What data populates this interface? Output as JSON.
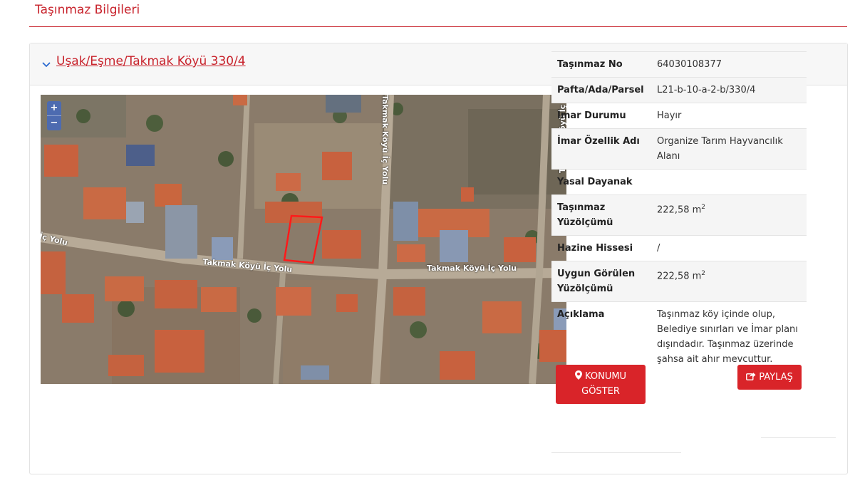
{
  "page": {
    "title": "Taşınmaz Bilgileri"
  },
  "panel": {
    "header_link": "Uşak/Eşme/Takmak Köyü 330/4"
  },
  "map": {
    "zoom_in": "+",
    "zoom_out": "−",
    "road_labels": [
      "İç Yolu",
      "Takmak Köyü İç Yolu",
      "Takmak Köyü İç Yolu",
      "Takmak Köyü İç Yolu",
      "Takmak Köyü İç Yolu"
    ]
  },
  "info": {
    "rows": [
      {
        "label": "Taşınmaz No",
        "value": "64030108377"
      },
      {
        "label": "Pafta/Ada/Parsel",
        "value": "L21-b-10-a-2-b/330/4"
      },
      {
        "label": "İmar Durumu",
        "value": "Hayır"
      },
      {
        "label": "İmar Özellik Adı",
        "value": "Organize Tarım Hayvancılık Alanı"
      },
      {
        "label": "Yasal Dayanak",
        "value": ""
      },
      {
        "label": "Taşınmaz Yüzölçümü",
        "value": "222,58 m",
        "unit_sup": "2"
      },
      {
        "label": "Hazine Hissesi",
        "value": "/"
      },
      {
        "label": "Uygun Görülen Yüzölçümü",
        "value": "222,58 m",
        "unit_sup": "2"
      },
      {
        "label": "Açıklama",
        "value": "Taşınmaz köy içinde olup, Belediye sınırları ve İmar planı dışındadır. Taşınmaz üzerinde şahsa ait ahır mevcuttur."
      }
    ]
  },
  "buttons": {
    "locate_line1": "KONUMU",
    "locate_line2": "GÖSTER",
    "share": "PAYLAŞ"
  },
  "colors": {
    "accent": "#c8232c",
    "button": "#d92429"
  },
  "icons": {
    "header": "chevron-down-icon",
    "locate": "map-marker-icon",
    "share": "share-icon"
  }
}
